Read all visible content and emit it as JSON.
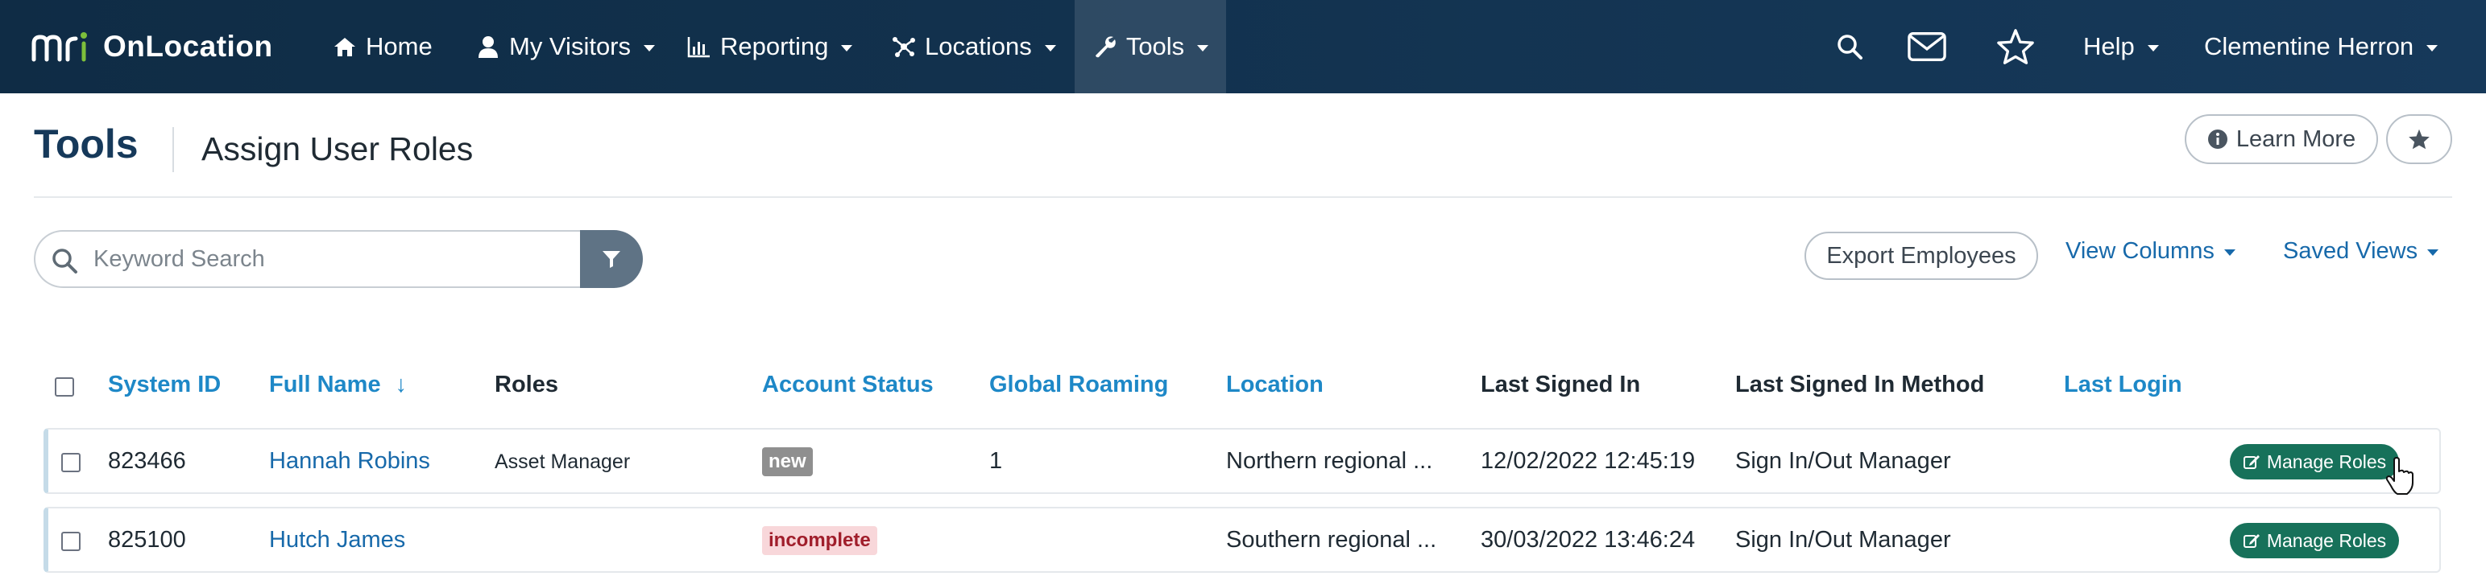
{
  "navbar": {
    "brand_mark": "mri",
    "brand_name": "OnLocation",
    "items": [
      {
        "label": "Home",
        "icon": "home-icon",
        "has_caret": false
      },
      {
        "label": "My Visitors",
        "icon": "user-icon",
        "has_caret": true
      },
      {
        "label": "Reporting",
        "icon": "bar-chart-icon",
        "has_caret": true
      },
      {
        "label": "Locations",
        "icon": "network-icon",
        "has_caret": true
      },
      {
        "label": "Tools",
        "icon": "wrench-icon",
        "has_caret": true,
        "active": true
      }
    ],
    "right": {
      "help_label": "Help",
      "user_name": "Clementine Herron",
      "icons": [
        "search-icon",
        "envelope-icon",
        "star-icon"
      ]
    },
    "colors": {
      "background": "#0f2c45",
      "brand_accent": "#7dbf3b"
    }
  },
  "header": {
    "title": "Tools",
    "subtitle": "Assign User Roles",
    "learn_more_label": "Learn More",
    "favorite_icon": "star-icon"
  },
  "toolbar": {
    "search_placeholder": "Keyword Search",
    "search_value": "",
    "filter_icon": "filter-icon",
    "export_label": "Export Employees",
    "view_columns_label": "View Columns",
    "saved_views_label": "Saved Views"
  },
  "table": {
    "columns": [
      "System ID",
      "Full Name",
      "Roles",
      "Account Status",
      "Global Roaming",
      "Location",
      "Last Signed In",
      "Last Signed In Method",
      "Last Login"
    ],
    "sort_indicator": "↓",
    "rows": [
      {
        "system_id": "823466",
        "full_name": "Hannah Robins",
        "roles": "Asset Manager",
        "account_status": "new",
        "global_roaming": "1",
        "location": "Northern regional ...",
        "last_signed_in": "12/02/2022 12:45:19",
        "last_signed_in_method": "Sign In/Out Manager",
        "last_login": "",
        "action_label": "Manage Roles"
      },
      {
        "system_id": "825100",
        "full_name": "Hutch James",
        "roles": "",
        "account_status": "incomplete",
        "global_roaming": "",
        "location": "Southern regional ...",
        "last_signed_in": "30/03/2022 13:46:24",
        "last_signed_in_method": "Sign In/Out Manager",
        "last_login": "",
        "action_label": "Manage Roles"
      }
    ],
    "colors": {
      "header_link": "#1e88c7",
      "action_button": "#17715a",
      "badge_new": "#8f8f8f",
      "badge_incomplete_bg": "#f8d7da",
      "badge_incomplete_text": "#a01e2b"
    }
  }
}
